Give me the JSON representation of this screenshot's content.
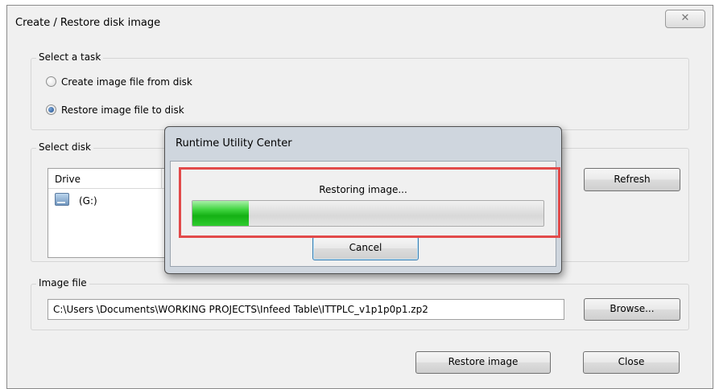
{
  "window": {
    "title": "Create / Restore disk image",
    "close_glyph": "✕"
  },
  "task_group": {
    "legend": "Select a task",
    "options": [
      {
        "label": "Create image file from disk",
        "selected": false
      },
      {
        "label": "Restore image file to disk",
        "selected": true
      }
    ]
  },
  "disk_group": {
    "legend": "Select disk",
    "columns": [
      "Drive"
    ],
    "rows": [
      {
        "drive": "(G:)",
        "icon": "drive-icon"
      }
    ],
    "refresh_label": "Refresh"
  },
  "image_group": {
    "legend": "Image file",
    "path": "C:\\Users \\Documents\\WORKING PROJECTS\\Infeed Table\\ITTPLC_v1p1p0p1.zp2",
    "browse_label": "Browse..."
  },
  "footer": {
    "restore_label": "Restore image",
    "close_label": "Close"
  },
  "progress_dialog": {
    "title": "Runtime Utility Center",
    "status": "Restoring image...",
    "progress_fraction": 0.16,
    "cancel_label": "Cancel",
    "progress_color": "#14b114",
    "highlight_color": "#e24a4a"
  }
}
